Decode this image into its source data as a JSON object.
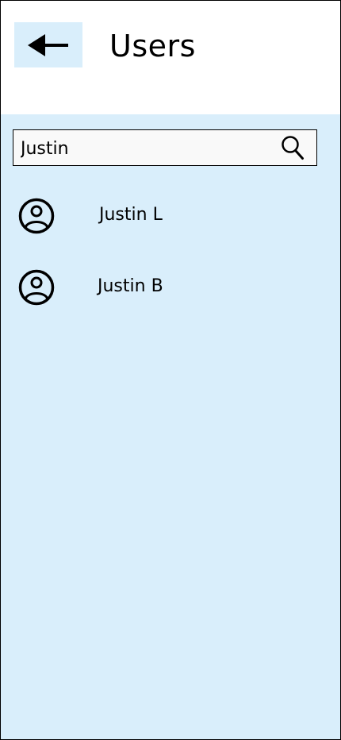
{
  "header": {
    "title": "Users",
    "back_icon": "arrow-left-icon"
  },
  "search": {
    "value": "Justin",
    "placeholder": "",
    "icon": "search-icon"
  },
  "users": [
    {
      "name": "Justin L",
      "icon": "user-circle-icon"
    },
    {
      "name": "Justin B",
      "icon": "user-circle-icon"
    }
  ],
  "colors": {
    "background": "#d9eefb",
    "header_background": "#ffffff",
    "search_background": "#f9f9f9",
    "text": "#000000"
  }
}
